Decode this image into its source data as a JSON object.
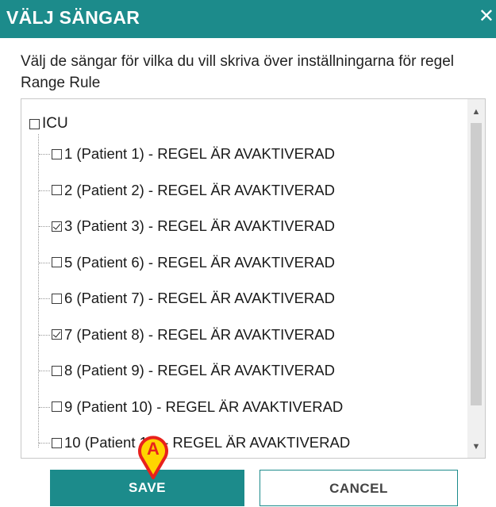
{
  "dialog": {
    "title": "VÄLJ SÄNGAR",
    "close_glyph": "✕",
    "description": "Välj de sängar för vilka du vill skriva över inställningarna för regel Range Rule"
  },
  "tree": {
    "root": {
      "label": "ICU",
      "checked": false
    },
    "items": [
      {
        "label": "1 (Patient 1) - REGEL ÄR AVAKTIVERAD",
        "checked": false
      },
      {
        "label": "2 (Patient 2) - REGEL ÄR AVAKTIVERAD",
        "checked": false
      },
      {
        "label": "3 (Patient 3) - REGEL ÄR AVAKTIVERAD",
        "checked": true
      },
      {
        "label": "5 (Patient 6) - REGEL ÄR AVAKTIVERAD",
        "checked": false
      },
      {
        "label": "6 (Patient 7) - REGEL ÄR AVAKTIVERAD",
        "checked": false
      },
      {
        "label": "7 (Patient 8) - REGEL ÄR AVAKTIVERAD",
        "checked": true
      },
      {
        "label": "8 (Patient 9) - REGEL ÄR AVAKTIVERAD",
        "checked": false
      },
      {
        "label": "9 (Patient 10) - REGEL ÄR AVAKTIVERAD",
        "checked": false
      },
      {
        "label": "10 (Patient 11) - REGEL ÄR AVAKTIVERAD",
        "checked": false
      }
    ]
  },
  "buttons": {
    "save_label": "SAVE",
    "cancel_label": "CANCEL"
  },
  "marker": {
    "label": "A",
    "color": "#e8211d",
    "fill": "#ffd400"
  },
  "colors": {
    "accent": "#1c8b8b"
  }
}
